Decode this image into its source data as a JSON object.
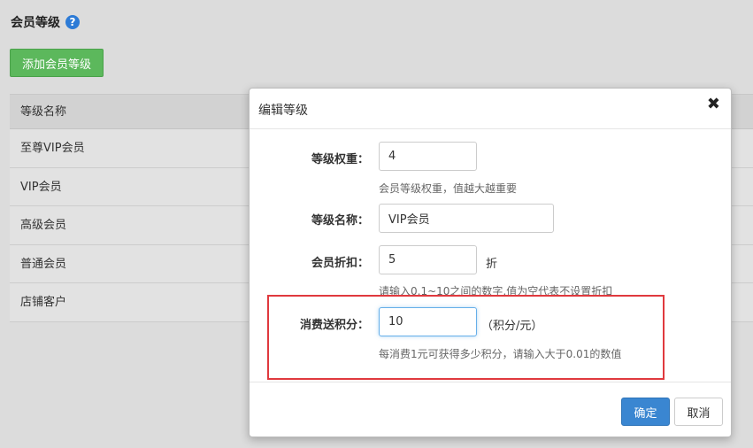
{
  "page": {
    "title": "会员等级",
    "help_icon": "?",
    "add_button": "添加会员等级"
  },
  "table": {
    "header": "等级名称",
    "rows": [
      "至尊VIP会员",
      "VIP会员",
      "高级会员",
      "普通会员",
      "店铺客户"
    ]
  },
  "modal": {
    "title": "编辑等级",
    "close_icon": "✖",
    "fields": {
      "weight": {
        "label": "等级权重：",
        "value": "4",
        "hint": "会员等级权重，值越大越重要"
      },
      "name": {
        "label": "等级名称：",
        "value": "VIP会员"
      },
      "discount": {
        "label": "会员折扣：",
        "value": "5",
        "suffix": "折",
        "hint": "请输入0.1~10之间的数字,值为空代表不设置折扣"
      },
      "points": {
        "label": "消费送积分：",
        "value": "10",
        "suffix": "（积分/元）",
        "hint": "每消费1元可获得多少积分，请输入大于0.01的数值"
      }
    },
    "ok_button": "确定",
    "cancel_button": "取消"
  },
  "colors": {
    "add_button": "#5cb85c",
    "ok_button": "#3a86d1",
    "highlight": "#e0393e"
  }
}
